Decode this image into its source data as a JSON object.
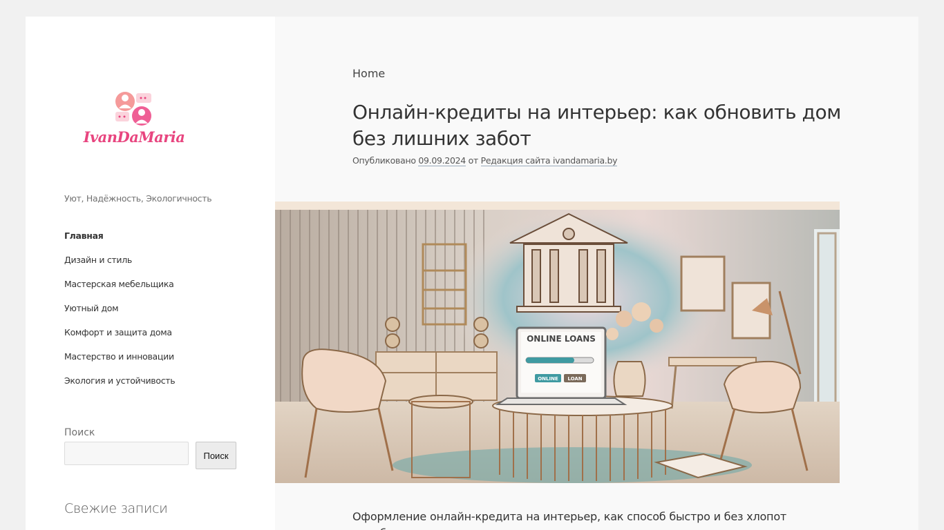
{
  "site": {
    "logo_text": "IvanDaMaria",
    "tagline": "Уют, Надёжность, Экологичность"
  },
  "nav": {
    "items": [
      {
        "label": "Главная",
        "active": true
      },
      {
        "label": "Дизайн и стиль"
      },
      {
        "label": "Мастерская мебельщика"
      },
      {
        "label": "Уютный дом"
      },
      {
        "label": "Комфорт и защита дома"
      },
      {
        "label": "Мастерство и инновации"
      },
      {
        "label": "Экология и устойчивость"
      }
    ]
  },
  "search": {
    "label": "Поиск",
    "value": "",
    "button_label": "Поиск"
  },
  "widgets": {
    "recent_title": "Свежие записи"
  },
  "post": {
    "breadcrumb": "Home",
    "title": "Онлайн-кредиты на интерьер: как обновить дом без лишних забот",
    "meta_prefix": "Опубликовано",
    "date": "09.09.2024",
    "meta_by": "от",
    "author": "Редакция сайта ivandamaria.by",
    "image_screen_title": "ONLINE LOANS",
    "image_btn_1": "ONLINE",
    "image_btn_2": "LOAN",
    "excerpt": "Оформление онлайн-кредита на интерьер, как способ быстро и без хлопот преобразить свое"
  },
  "colors": {
    "brand": "#e8457f",
    "page_bg": "#f1f1f1",
    "content_bg": "#f9f9f9",
    "sidebar_bg": "#ffffff"
  },
  "icons": {
    "logo": "people-chat-icon"
  }
}
